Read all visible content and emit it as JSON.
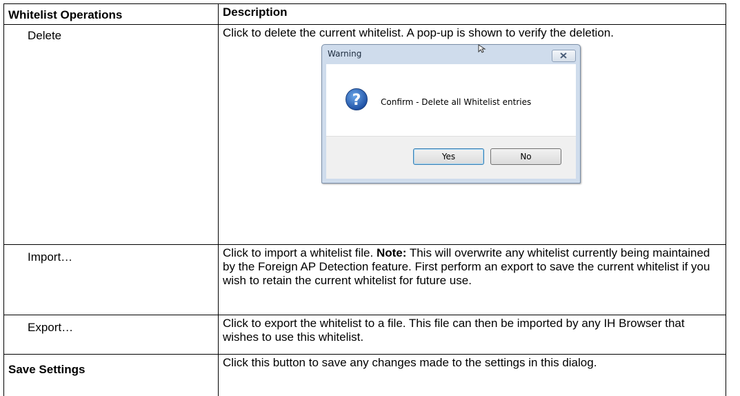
{
  "table": {
    "headers": [
      "Whitelist Operations",
      "Description"
    ],
    "rows": [
      {
        "op": "Delete",
        "desc": "Click to delete the current whitelist. A pop-up is shown to verify the deletion."
      },
      {
        "op": "Import…",
        "desc_pre": "Click to import a whitelist file. ",
        "note_label": "Note:",
        "desc_post": " This will overwrite any whitelist currently being maintained by the Foreign AP Detection feature. First perform an export to save the current whitelist if you wish to retain the current whitelist for future use."
      },
      {
        "op": "Export…",
        "desc": "Click to export the whitelist to a file. This file can then be imported by any IH Browser that wishes to use this whitelist."
      },
      {
        "op": "Save Settings",
        "desc": "Click this button to save any changes made to the settings in this dialog."
      }
    ]
  },
  "dialog": {
    "title": "Warning",
    "message": "Confirm - Delete all Whitelist entries",
    "yes_label": "Yes",
    "no_label": "No",
    "icons": [
      "close-icon",
      "question-icon",
      "cursor-icon"
    ]
  }
}
